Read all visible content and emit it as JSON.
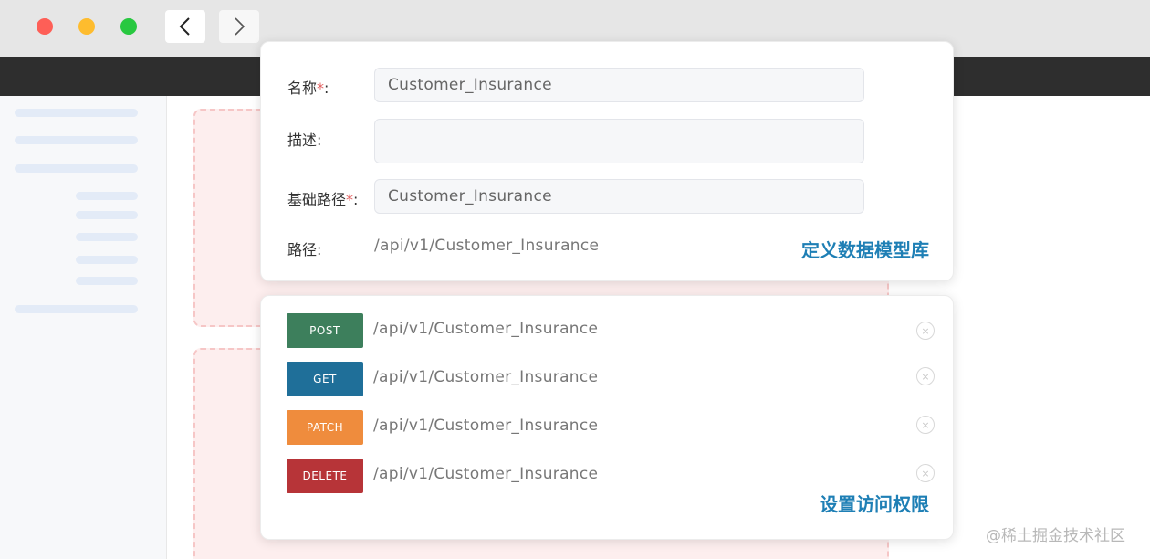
{
  "form": {
    "name_label": "名称",
    "name_required": "*",
    "label_suffix": ":",
    "name_value": "Customer_Insurance",
    "desc_label": "描述:",
    "desc_value": "",
    "basepath_label": "基础路径",
    "basepath_required": "*",
    "basepath_value": "Customer_Insurance",
    "path_label": "路径:",
    "path_value": "/api/v1/Customer_Insurance",
    "caption": "定义数据模型库"
  },
  "routes": {
    "items": [
      {
        "method": "POST",
        "path": "/api/v1/Customer_Insurance",
        "color": "#3d7f5c"
      },
      {
        "method": "GET",
        "path": "/api/v1/Customer_Insurance",
        "color": "#1f6f99"
      },
      {
        "method": "PATCH",
        "path": "/api/v1/Customer_Insurance",
        "color": "#ef8c3d"
      },
      {
        "method": "DELETE",
        "path": "/api/v1/Customer_Insurance",
        "color": "#b73438"
      }
    ],
    "remove_icon": "×",
    "caption": "设置访问权限"
  },
  "watermark": "@稀土掘金技术社区"
}
